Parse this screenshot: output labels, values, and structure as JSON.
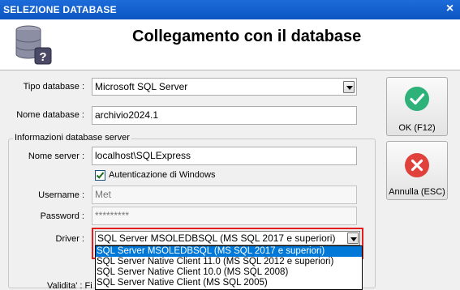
{
  "window": {
    "title": "SELEZIONE DATABASE",
    "close_glyph": "×"
  },
  "header": {
    "heading": "Collegamento con il database",
    "logo_icon": "database-help-icon"
  },
  "form": {
    "tipo_database": {
      "label": "Tipo database :",
      "value": "Microsoft SQL Server"
    },
    "nome_database": {
      "label": "Nome database :",
      "value": "archivio2024.1"
    }
  },
  "server_group": {
    "legend": "Informazioni database server",
    "nome_server": {
      "label": "Nome server :",
      "value": "localhost\\SQLExpress"
    },
    "auth_checkbox": {
      "label": "Autenticazione di Windows",
      "checked": true
    },
    "username": {
      "label": "Username :",
      "value": "Met"
    },
    "password": {
      "label": "Password :",
      "value": "*********"
    },
    "driver": {
      "label": "Driver :",
      "selected": "SQL Server MSOLEDBSQL (MS SQL 2017 e superiori)",
      "options": [
        "SQL Server MSOLEDBSQL (MS SQL 2017 e superiori)",
        "SQL Server Native Client 11.0 (MS SQL 2012 e superiori)",
        "SQL Server Native Client 10.0 (MS SQL 2008)",
        "SQL Server Native Client (MS SQL 2005)"
      ]
    }
  },
  "buttons": {
    "ok": {
      "label": "OK (F12)",
      "icon": "check-icon",
      "color": "#2fb27a"
    },
    "cancel": {
      "label": "Annulla (ESC)",
      "icon": "cross-icon",
      "color": "#e0413a"
    }
  },
  "bottom": {
    "text": "Validita' : Fi"
  },
  "colors": {
    "titlebar": "#0a55c2",
    "highlight_outline": "#e41e1e",
    "selection": "#0078d7"
  }
}
